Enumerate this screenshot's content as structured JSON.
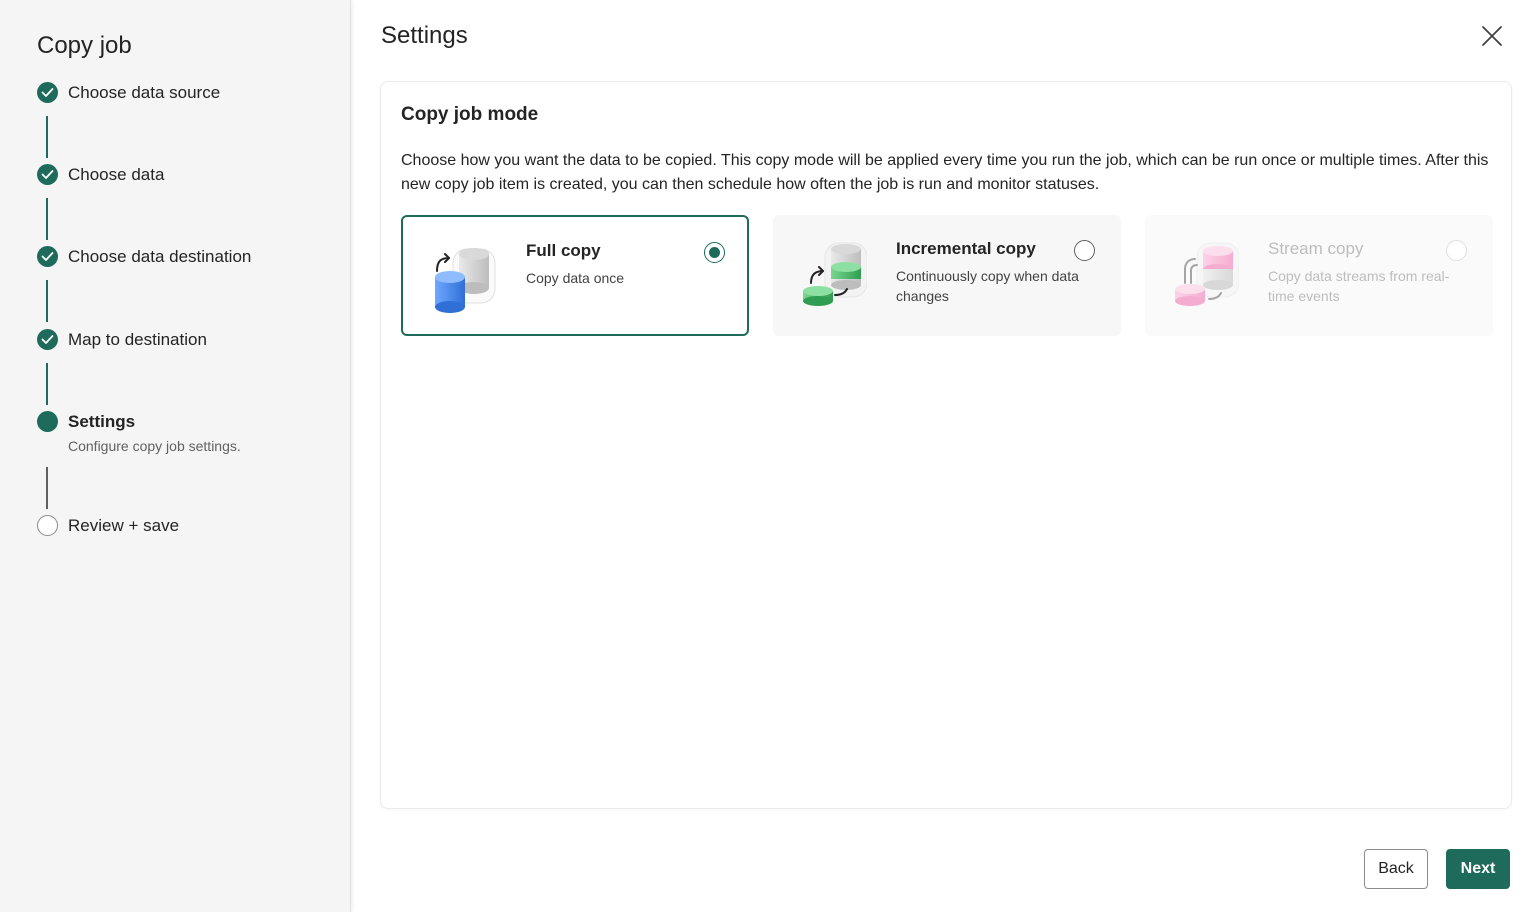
{
  "sidebar": {
    "title": "Copy job",
    "steps": [
      {
        "label": "Choose data source",
        "status": "done"
      },
      {
        "label": "Choose data",
        "status": "done"
      },
      {
        "label": "Choose data destination",
        "status": "done"
      },
      {
        "label": "Map to destination",
        "status": "done"
      },
      {
        "label": "Settings",
        "status": "current",
        "sublabel": "Configure copy job settings."
      },
      {
        "label": "Review + save",
        "status": "pending"
      }
    ]
  },
  "main": {
    "title": "Settings",
    "close_icon": "close-icon",
    "panel": {
      "title": "Copy job mode",
      "description": "Choose how you want the data to be copied. This copy mode will be applied every time you run the job, which can be run once or multiple times. After this new copy job item is created, you can then schedule how often the job is run and monitor statuses.",
      "options": [
        {
          "title": "Full copy",
          "description": "Copy data once",
          "icon": "full-copy-icon",
          "selected": true,
          "disabled": false
        },
        {
          "title": "Incremental copy",
          "description": "Continuously copy when data changes",
          "icon": "incremental-copy-icon",
          "selected": false,
          "disabled": false
        },
        {
          "title": "Stream copy",
          "description": "Copy data streams from real-time events",
          "icon": "stream-copy-icon",
          "selected": false,
          "disabled": true
        }
      ]
    }
  },
  "footer": {
    "back_label": "Back",
    "next_label": "Next"
  },
  "colors": {
    "accent": "#1e6b5c",
    "sidebar_bg": "#f5f5f5"
  }
}
